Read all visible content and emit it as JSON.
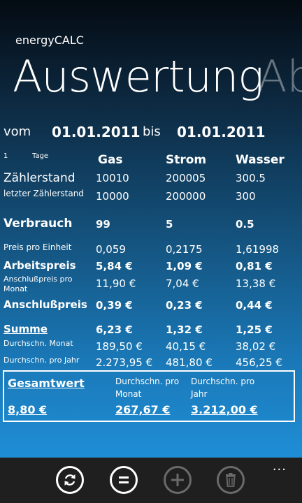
{
  "app": {
    "title": "energyCALC"
  },
  "pivot": {
    "current": "Auswertung",
    "next": "Ab"
  },
  "period": {
    "from_label": "vom",
    "from": "01.01.2011",
    "to_label": "bis",
    "to": "01.01.2011"
  },
  "days": {
    "count": "1",
    "label": "Tage"
  },
  "columns": [
    "Gas",
    "Strom",
    "Wasser"
  ],
  "rows": {
    "zaehlerstand": {
      "label": "Zählerstand",
      "values": [
        "10010",
        "200005",
        "300.5"
      ]
    },
    "letzter": {
      "label": "letzter Zählerstand",
      "values": [
        "10000",
        "200000",
        "300"
      ]
    },
    "verbrauch": {
      "label": "Verbrauch",
      "values": [
        "99",
        "5",
        "0.5"
      ]
    },
    "preis_einheit": {
      "label": "Preis pro Einheit",
      "values": [
        "0,059",
        "0,2175",
        "1,61998"
      ]
    },
    "arbeitspreis": {
      "label": "Arbeitspreis",
      "values": [
        "5,84 €",
        "1,09 €",
        "0,81 €"
      ]
    },
    "anschluss_monat": {
      "label_line1": "Anschlußpreis pro",
      "label_line2": "Monat",
      "values": [
        "11,90 €",
        "7,04 €",
        "13,38 €"
      ]
    },
    "anschlusspreis": {
      "label": "Anschlußpreis",
      "values": [
        "0,39 €",
        "0,23 €",
        "0,44 €"
      ]
    },
    "summe": {
      "label": "Summe",
      "values": [
        "6,23 €",
        "1,32 €",
        "1,25 €"
      ]
    },
    "dur_monat": {
      "label": "Durchschn. Monat",
      "values": [
        "189,50 €",
        "40,15 €",
        "38,02 €"
      ]
    },
    "dur_jahr": {
      "label": "Durchschn. pro Jahr",
      "values": [
        "2.273,95 €",
        "481,80 €",
        "456,25 €"
      ]
    }
  },
  "gesamt": {
    "label": "Gesamtwert",
    "value": "8,80 €",
    "monat_label_line1": "Durchschn. pro",
    "monat_label_line2": "Monat",
    "monat_value": "267,67 €",
    "jahr_label_line1": "Durchschn. pro",
    "jahr_label_line2": "Jahr",
    "jahr_value": "3.212,00 €"
  },
  "appbar": {
    "buttons": [
      "refresh-icon",
      "equals-icon",
      "add-icon",
      "delete-icon"
    ],
    "more": "..."
  }
}
